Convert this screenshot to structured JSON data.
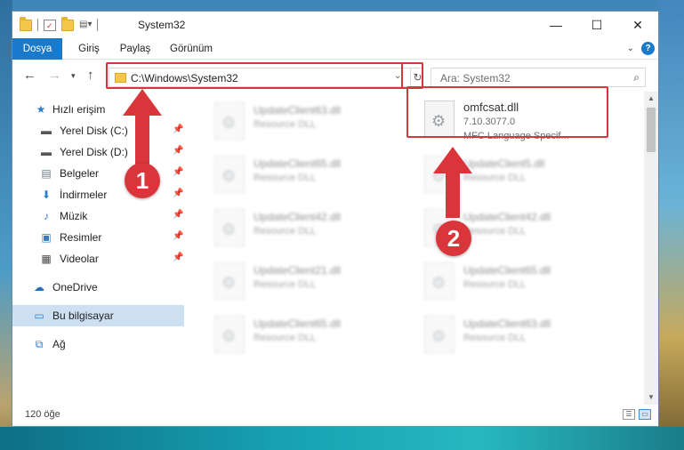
{
  "window": {
    "title": "System32",
    "controls": {
      "minimize": "—",
      "maximize": "☐",
      "close": "✕"
    }
  },
  "ribbon": {
    "tabs": [
      {
        "label": "Dosya",
        "active": true
      },
      {
        "label": "Giriş",
        "active": false
      },
      {
        "label": "Paylaş",
        "active": false
      },
      {
        "label": "Görünüm",
        "active": false
      }
    ]
  },
  "nav": {
    "address": "C:\\Windows\\System32",
    "search_placeholder": "Ara: System32"
  },
  "sidebar": {
    "items": [
      {
        "label": "Hızlı erişim",
        "icon": "star-icon",
        "pinned": false,
        "selected": false
      },
      {
        "label": "Yerel Disk (C:)",
        "icon": "drive-icon",
        "pinned": true,
        "selected": false
      },
      {
        "label": "Yerel Disk (D:)",
        "icon": "drive-icon",
        "pinned": true,
        "selected": false
      },
      {
        "label": "Belgeler",
        "icon": "documents-icon",
        "pinned": true,
        "selected": false
      },
      {
        "label": "İndirmeler",
        "icon": "download-icon",
        "pinned": true,
        "selected": false
      },
      {
        "label": "Müzik",
        "icon": "music-icon",
        "pinned": true,
        "selected": false
      },
      {
        "label": "Resimler",
        "icon": "pictures-icon",
        "pinned": true,
        "selected": false
      },
      {
        "label": "Videolar",
        "icon": "video-icon",
        "pinned": true,
        "selected": false
      },
      {
        "label": "OneDrive",
        "icon": "cloud-icon",
        "pinned": false,
        "selected": false
      },
      {
        "label": "Bu bilgisayar",
        "icon": "computer-icon",
        "pinned": false,
        "selected": true
      },
      {
        "label": "Ağ",
        "icon": "network-icon",
        "pinned": false,
        "selected": false
      }
    ]
  },
  "files": {
    "left": [
      {
        "name": "UpdateClient63.dll",
        "type": "Resource DLL"
      },
      {
        "name": "UpdateClient65.dll",
        "type": "Resource DLL"
      },
      {
        "name": "UpdateClient42.dll",
        "type": "Resource DLL"
      },
      {
        "name": "UpdateClient21.dll",
        "type": "Resource DLL"
      },
      {
        "name": "UpdateClient65.dll",
        "type": "Resource DLL"
      }
    ],
    "highlighted": {
      "name": "omfcsat.dll",
      "version": "7.10.3077.0",
      "description": "MFC Language Specif..."
    },
    "right": [
      {
        "name": "UpdateClient5.dll",
        "type": "Resource DLL"
      },
      {
        "name": "UpdateClient42.dll",
        "type": "Resource DLL"
      },
      {
        "name": "UpdateClient65.dll",
        "type": "Resource DLL"
      },
      {
        "name": "UpdateClient63.dll",
        "type": "Resource DLL"
      }
    ]
  },
  "status": {
    "item_count": "120 öğe"
  },
  "annotations": {
    "step1": "1",
    "step2": "2",
    "color": "#d9353b"
  }
}
